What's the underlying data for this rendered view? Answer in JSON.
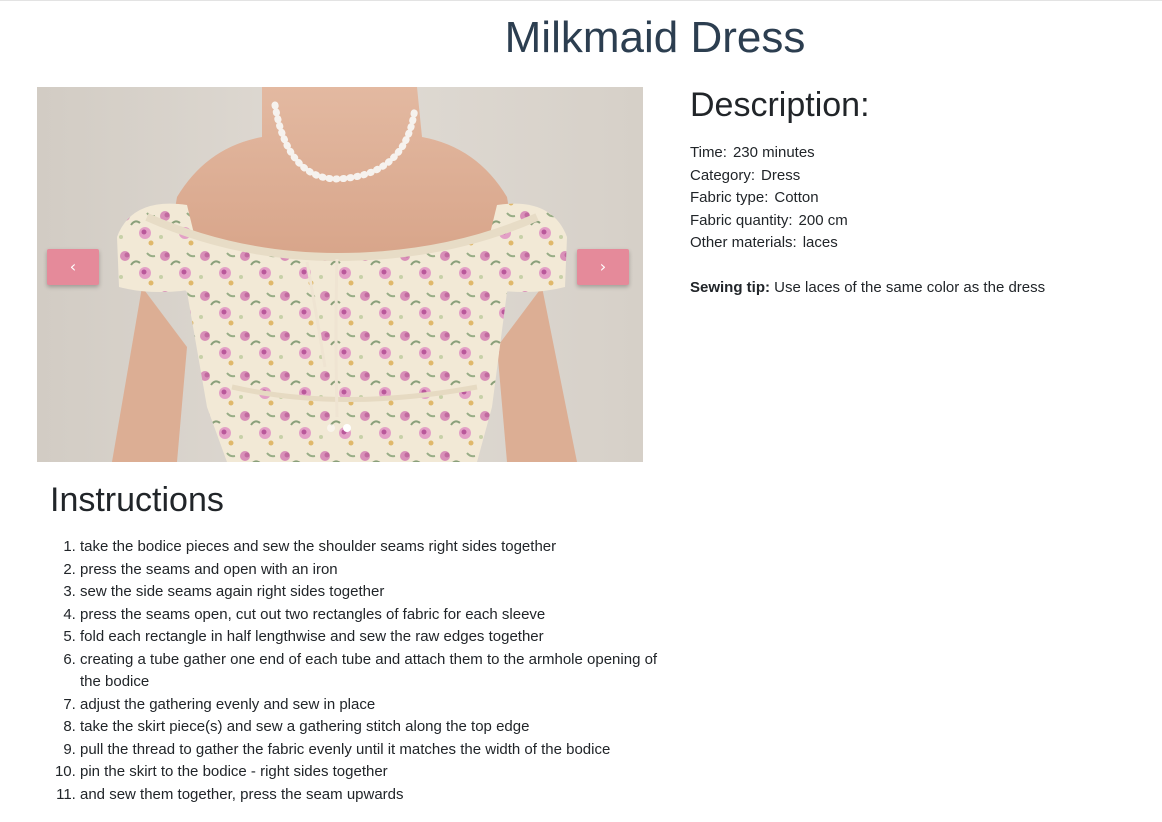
{
  "page": {
    "title": "Milkmaid Dress"
  },
  "carousel": {
    "image_alt": "Milkmaid Dress",
    "prev_icon": "chevron-left-icon",
    "next_icon": "chevron-right-icon",
    "prev_glyph": "‹",
    "next_glyph": "›",
    "slide_count": 2,
    "active_slide": 2,
    "button_color": "#e58a9a"
  },
  "description": {
    "heading": "Description:",
    "fields": [
      {
        "label": "Time:",
        "value": "230 minutes"
      },
      {
        "label": "Category:",
        "value": "Dress"
      },
      {
        "label": "Fabric type:",
        "value": "Cotton"
      },
      {
        "label": "Fabric quantity:",
        "value": "200 cm"
      },
      {
        "label": "Other materials:",
        "value": "laces"
      }
    ],
    "tip_label": "Sewing tip:",
    "tip_text": "Use laces of the same color as the dress"
  },
  "instructions": {
    "heading": "Instructions",
    "steps": [
      "take the bodice pieces and sew the shoulder seams right sides together",
      "press the seams and open with an iron",
      "sew the side seams again right sides together",
      "press the seams open, cut out two rectangles of fabric for each sleeve",
      "fold each rectangle in half lengthwise and sew the raw edges together",
      "creating a tube gather one end of each tube and attach them to the armhole opening of the bodice",
      "adjust the gathering evenly and sew in place",
      "take the skirt piece(s) and sew a gathering stitch along the top edge",
      "pull the thread to gather the fabric evenly until it matches the width of the bodice",
      "pin the skirt to the bodice - right sides together",
      "and sew them together, press the seam upwards"
    ]
  }
}
